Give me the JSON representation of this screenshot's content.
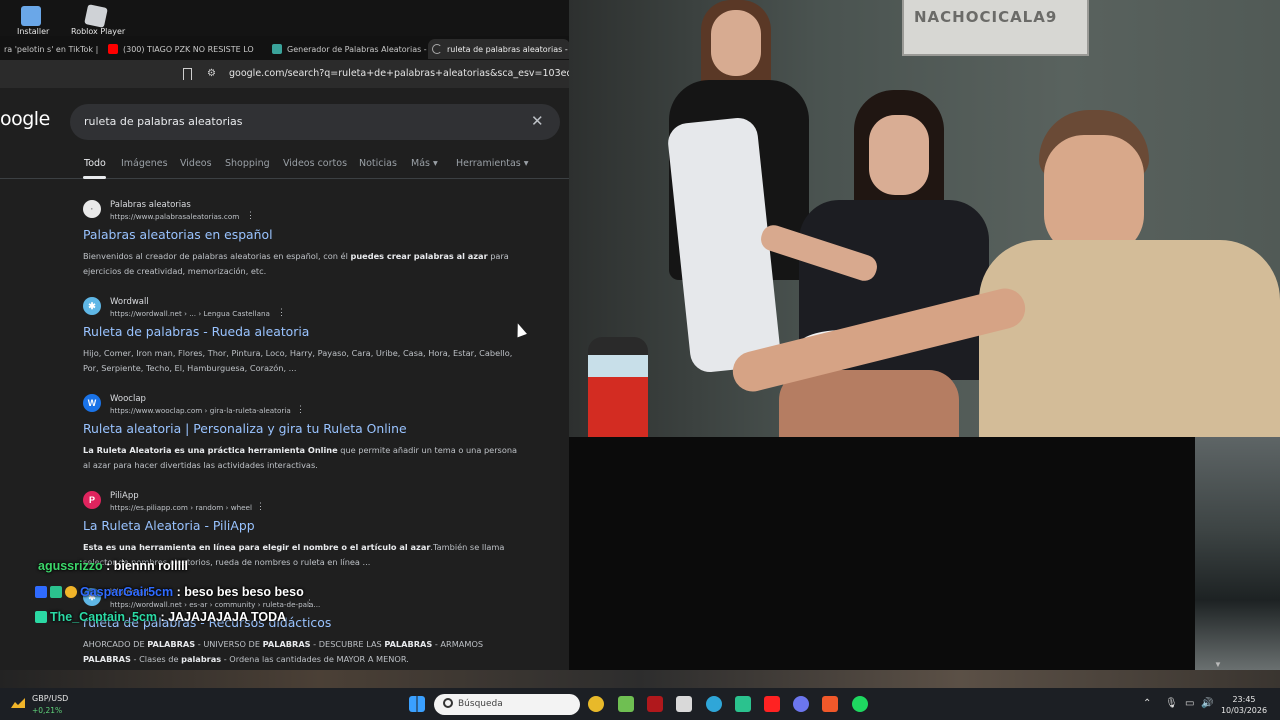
{
  "desktop": {
    "icons": [
      {
        "label": "Installer",
        "color": "#6aa7e8"
      },
      {
        "label": "Roblox Player",
        "color": "#cfd2d6"
      }
    ]
  },
  "browser": {
    "tabs": [
      {
        "label": "ra 'pelotin s' en TikTok | I",
        "icon": "tiktok-icon",
        "color": "#333333"
      },
      {
        "label": "(300) TIAGO PZK NO RESISTE LOS C",
        "icon": "youtube-icon",
        "color": "#ff0000"
      },
      {
        "label": "Generador de Palabras Aleatorias - J",
        "icon": "site-icon",
        "color": "#3aa39a"
      },
      {
        "label": "ruleta de palabras aleatorias - B",
        "icon": "loading-icon",
        "color": "#aaaaaa"
      }
    ],
    "url": "google.com/search?q=ruleta+de+palabras+aleatorias&sca_esv=103eda2c29df25d"
  },
  "google": {
    "logo": "oogle",
    "query": "ruleta de palabras aleatorias",
    "filters": [
      "Todo",
      "Imágenes",
      "Videos",
      "Shopping",
      "Videos cortos",
      "Noticias",
      "Más ▾",
      "Herramientas ▾"
    ],
    "results": [
      {
        "site": "Palabras aleatorias",
        "url": "https://www.palabrasaleatorias.com",
        "title": "Palabras aleatorias en español",
        "snippet_html": "Bienvenidos al creador de palabras aleatorias en español, con él <b>puedes crear palabras al azar</b> para ejercicios de creatividad, memorización, etc.",
        "fav_bg": "#e9e9e9",
        "fav_fg": "#888888",
        "fav_glyph": "·"
      },
      {
        "site": "Wordwall",
        "url": "https://wordwall.net › ... › Lengua Castellana",
        "title": "Ruleta de palabras - Rueda aleatoria",
        "snippet_html": "Hijo, Comer, Iron man, Flores, Thor, Pintura, Loco, Harry, Payaso, Cara, Uribe, Casa, Hora, Estar, Cabello, Por, Serpiente, Techo, El, Hamburguesa, Corazón, ...",
        "fav_bg": "#5fb7e6",
        "fav_fg": "#ffffff",
        "fav_glyph": "✱"
      },
      {
        "site": "Wooclap",
        "url": "https://www.wooclap.com › gira-la-ruleta-aleatoria",
        "title": "Ruleta aleatoria | Personaliza y gira tu Ruleta Online",
        "snippet_html": "<b>La Ruleta Aleatoria es una práctica herramienta Online</b> que permite añadir un tema o una persona al azar para hacer divertidas las actividades interactivas.",
        "fav_bg": "#1a73e8",
        "fav_fg": "#ffffff",
        "fav_glyph": "W"
      },
      {
        "site": "PiliApp",
        "url": "https://es.piliapp.com › random › wheel",
        "title": "La Ruleta Aleatoria - PiliApp",
        "snippet_html": "<b>Esta es una herramienta en línea para elegir el nombre o el artículo al azar</b>.También se llama selector de nombres aleatorios, rueda de nombres o ruleta en línea ...",
        "fav_bg": "#e0245e",
        "fav_fg": "#ffffff",
        "fav_glyph": "P"
      },
      {
        "site": "Wordwall",
        "url": "https://wordwall.net › es-ar › community › ruleta-de-pala...",
        "title": "ruleta de palabras - Recursos didácticos",
        "snippet_html": "AHORCADO DE <b>PALABRAS</b> - UNIVERSO DE <b>PALABRAS</b> - DESCUBRE LAS <b>PALABRAS</b> - ARMAMOS <b>PALABRAS</b> - Clases de <b>palabras</b> - Ordena las cantidades de MAYOR A MENOR.",
        "fav_bg": "#5fb7e6",
        "fav_fg": "#ffffff",
        "fav_glyph": "✱"
      }
    ]
  },
  "chat": [
    {
      "user": "agussrizzo",
      "color": "#3cd66a",
      "message": " : biennn rolllll"
    },
    {
      "user": "GasparGair5cm",
      "color": "#2f6bff",
      "message": " : beso bes beso beso"
    },
    {
      "user": "The_Captain_5cm",
      "color": "#2bd9a4",
      "message": " : JAJAJAJAJA TODA"
    }
  ],
  "camera": {
    "sign": "NACHOCICALA9"
  },
  "taskbar": {
    "ticker": "GBP/USD",
    "change": "+0,21%",
    "search_placeholder": "Búsqueda",
    "time": "23:45",
    "date": "10/03/2026",
    "apps": [
      {
        "name": "chrome-icon",
        "color": "#e8b92a"
      },
      {
        "name": "file-explorer-icon",
        "color": "#6fbf52"
      },
      {
        "name": "game-icon",
        "color": "#b0181c"
      },
      {
        "name": "mail-icon",
        "color": "#d9d9d9"
      },
      {
        "name": "edge-icon",
        "color": "#2fa6d8"
      },
      {
        "name": "store-icon",
        "color": "#2bc28e"
      },
      {
        "name": "youtube-icon",
        "color": "#ff2222"
      },
      {
        "name": "discord-icon",
        "color": "#6c76ee"
      },
      {
        "name": "brave-icon",
        "color": "#f0582a"
      },
      {
        "name": "spotify-icon",
        "color": "#1ed760"
      }
    ]
  }
}
